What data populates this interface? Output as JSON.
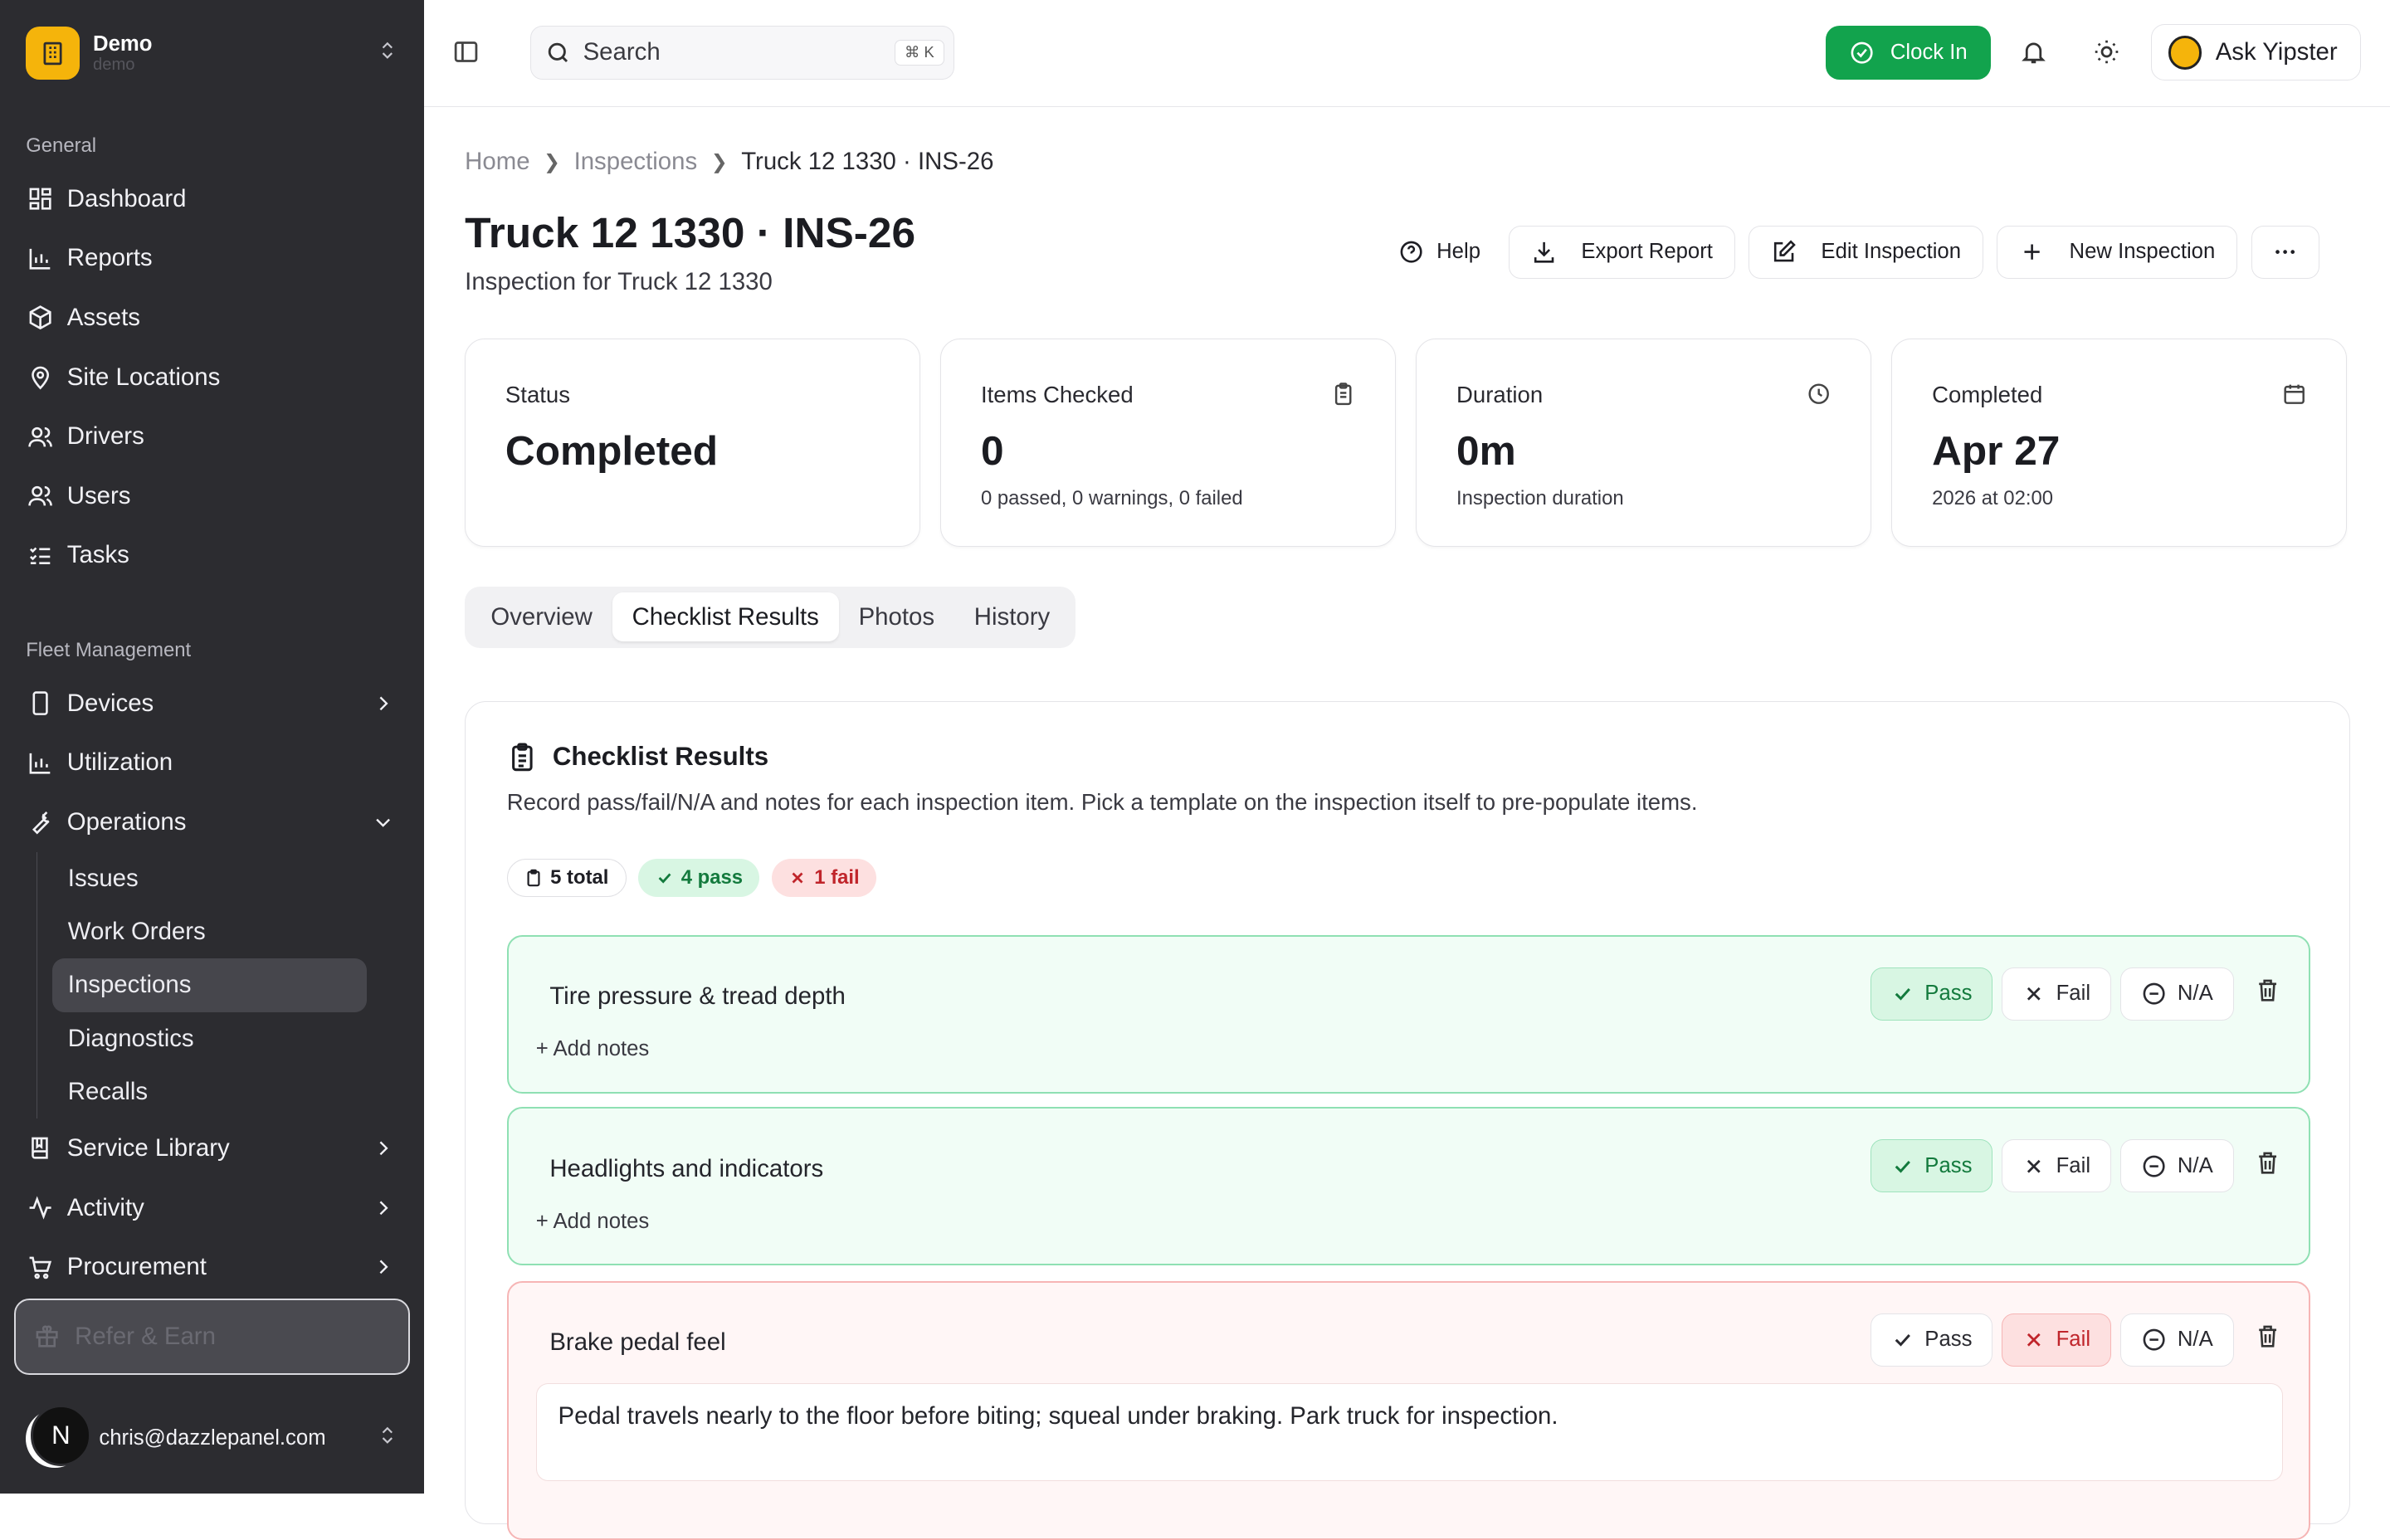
{
  "org": {
    "name": "Demo",
    "sub": "demo"
  },
  "sidebar": {
    "general_label": "General",
    "general": [
      {
        "label": "Dashboard",
        "icon": "dashboard-icon"
      },
      {
        "label": "Reports",
        "icon": "bar-chart-icon"
      },
      {
        "label": "Assets",
        "icon": "box-icon"
      },
      {
        "label": "Site Locations",
        "icon": "map-pin-icon"
      },
      {
        "label": "Drivers",
        "icon": "users-icon"
      },
      {
        "label": "Users",
        "icon": "users-icon"
      },
      {
        "label": "Tasks",
        "icon": "list-check-icon"
      }
    ],
    "fleet_label": "Fleet Management",
    "fleet": {
      "devices": "Devices",
      "utilization": "Utilization",
      "operations": "Operations",
      "ops_children": [
        "Issues",
        "Work Orders",
        "Inspections",
        "Diagnostics",
        "Recalls"
      ],
      "active_child": "Inspections",
      "service_library": "Service Library",
      "activity": "Activity",
      "procurement": "Procurement"
    },
    "refer": "Refer & Earn",
    "user_initial": "N",
    "user_email": "chris@dazzlepanel.com"
  },
  "topbar": {
    "search_placeholder": "Search",
    "search_shortcut": "⌘ K",
    "clock_in": "Clock In",
    "ask": "Ask Yipster"
  },
  "breadcrumbs": [
    "Home",
    "Inspections",
    "Truck 12 1330 · INS-26"
  ],
  "page": {
    "title": "Truck 12 1330 · INS-26",
    "subtitle": "Inspection for Truck 12 1330",
    "actions": {
      "help": "Help",
      "export": "Export Report",
      "edit": "Edit Inspection",
      "new": "New Inspection"
    }
  },
  "cards": [
    {
      "label": "Status",
      "value": "Completed",
      "sub": ""
    },
    {
      "label": "Items Checked",
      "value": "0",
      "sub": "0 passed, 0 warnings, 0 failed"
    },
    {
      "label": "Duration",
      "value": "0m",
      "sub": "Inspection duration"
    },
    {
      "label": "Completed",
      "value": "Apr 27",
      "sub": "2026 at 02:00"
    }
  ],
  "tabs": [
    "Overview",
    "Checklist Results",
    "Photos",
    "History"
  ],
  "active_tab": "Checklist Results",
  "checklist": {
    "title": "Checklist Results",
    "description": "Record pass/fail/N/A and notes for each inspection item. Pick a template on the inspection itself to pre-populate items.",
    "chips": {
      "total": "5 total",
      "pass": "4 pass",
      "fail": "1 fail"
    },
    "buttons": {
      "pass": "Pass",
      "fail": "Fail",
      "na": "N/A",
      "add_notes": "+ Add notes"
    },
    "items": [
      {
        "name": "Tire pressure & tread depth",
        "result": "pass"
      },
      {
        "name": "Headlights and indicators",
        "result": "pass"
      },
      {
        "name": "Brake pedal feel",
        "result": "fail",
        "notes": "Pedal travels nearly to the floor before biting; squeal under braking. Park truck for inspection."
      }
    ]
  },
  "colors": {
    "accent_green": "#12a34d",
    "sidebar_bg": "#2c2c30",
    "brand_yellow": "#f5b40b",
    "fail_red": "#c0252b"
  }
}
